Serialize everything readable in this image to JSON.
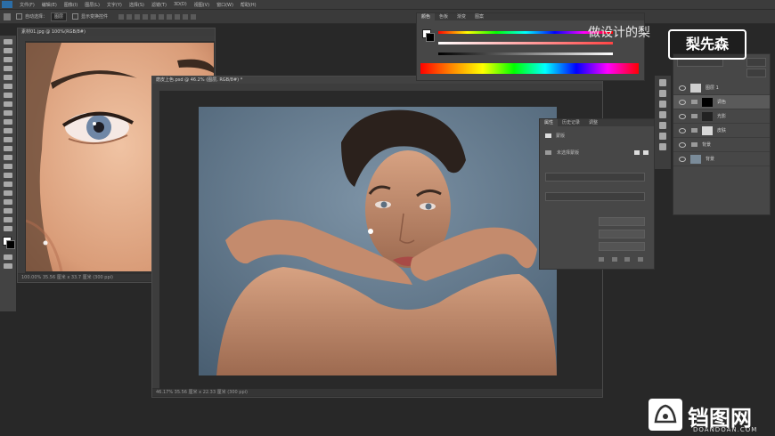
{
  "menu": {
    "items": [
      "文件(F)",
      "编辑(E)",
      "图像(I)",
      "图层(L)",
      "文字(Y)",
      "选择(S)",
      "滤镜(T)",
      "3D(D)",
      "视图(V)",
      "窗口(W)",
      "帮助(H)"
    ]
  },
  "options": {
    "auto_select_label": "自动选择：",
    "auto_select_value": "图层",
    "transform_label": "显示变换控件"
  },
  "doc_left": {
    "tab_title": "素材01.jpg @ 100%(RGB/8#)",
    "status": "100.00%   35.56 厘米 x 33.7 厘米 (300 ppi)"
  },
  "doc_main": {
    "tab_title": "磨皮上色.psd @ 46.2% (图层, RGB/8#) *",
    "status": "46.17%   35.56 厘米 x 22.33 厘米 (300 ppi)"
  },
  "color_panel": {
    "tabs": [
      "颜色",
      "色板",
      "渐变",
      "图案"
    ]
  },
  "properties_panel": {
    "tabs": [
      "属性",
      "历史记录",
      "调整"
    ],
    "mask_label": "蒙版",
    "no_mask_label": "未选择蒙版"
  },
  "layers_panel": {
    "layers": [
      {
        "name": "图层 1",
        "kind": "layer"
      },
      {
        "name": "调色",
        "kind": "group"
      },
      {
        "name": "光影",
        "kind": "group"
      },
      {
        "name": "皮肤",
        "kind": "group"
      },
      {
        "name": "背景",
        "kind": "group"
      },
      {
        "name": "背景",
        "kind": "layer"
      }
    ]
  },
  "overlay": {
    "caption": "做设计的梨",
    "badge": "梨先森",
    "site_name": "铛图网",
    "site_url": "DOANDOAN.COM"
  },
  "colors": {
    "ps_blue": "#2b6da6",
    "backdrop": "#5a7185",
    "skin": "#c99377"
  }
}
